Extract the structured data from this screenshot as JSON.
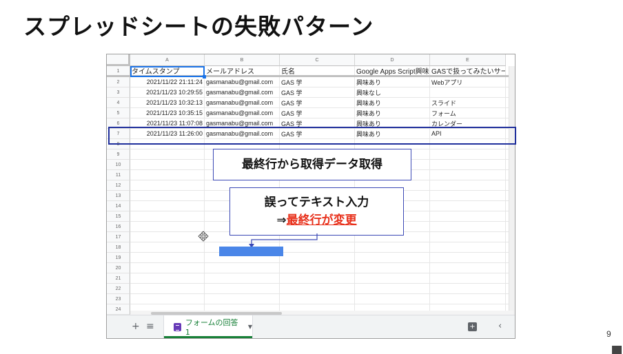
{
  "slide": {
    "title": "スプレッドシートの失敗パターン",
    "page_number": "9"
  },
  "spreadsheet": {
    "column_letters": [
      "A",
      "B",
      "C",
      "D",
      "E"
    ],
    "row_numbers": [
      "1",
      "2",
      "3",
      "4",
      "5",
      "6",
      "7",
      "8",
      "9",
      "10",
      "11",
      "12",
      "13",
      "14",
      "15",
      "16",
      "17",
      "18",
      "19",
      "20",
      "21",
      "22",
      "23",
      "24"
    ],
    "header_row": [
      "タイムスタンプ",
      "メールアドレス",
      "氏名",
      "Google Apps Script興味が",
      "GASで扱ってみたいサー"
    ],
    "rows": [
      [
        "2021/11/22 21:11:24",
        "gasmanabu@gmail.com",
        "GAS 学",
        "興味あり",
        "Webアプリ"
      ],
      [
        "2021/11/23 10:29:55",
        "gasmanabu@gmail.com",
        "GAS 学",
        "興味なし",
        ""
      ],
      [
        "2021/11/23 10:32:13",
        "gasmanabu@gmail.com",
        "GAS 学",
        "興味あり",
        "スライド"
      ],
      [
        "2021/11/23 10:35:15",
        "gasmanabu@gmail.com",
        "GAS 学",
        "興味あり",
        "フォーム"
      ],
      [
        "2021/11/23 11:07:08",
        "gasmanabu@gmail.com",
        "GAS 学",
        "興味あり",
        "カレンダー"
      ],
      [
        "2021/11/23 11:26:00",
        "gasmanabu@gmail.com",
        "GAS 学",
        "興味あり",
        "API"
      ]
    ],
    "sheet_tab_label": "フォームの回答 1"
  },
  "callouts": {
    "last_row_fetch": "最終行から取得データ取得",
    "mistake_line1": "誤ってテキスト入力",
    "mistake_arrow": "⇒",
    "mistake_accent": "最終行が変更"
  },
  "icons": {
    "add_sheet": "plus-icon",
    "all_sheets": "menu-icon",
    "form": "form-icon",
    "explore": "explore-icon",
    "collapse": "chevron-left-icon",
    "cursor": "move-cursor-icon"
  },
  "colors": {
    "highlight_border": "#1f2f9c",
    "callout_border": "#3a48b5",
    "accent_red": "#e8311c",
    "selection_blue": "#1a73e8",
    "filled_block": "#4a86e8",
    "sheet_tab_green": "#188038",
    "form_purple": "#673ab7"
  }
}
